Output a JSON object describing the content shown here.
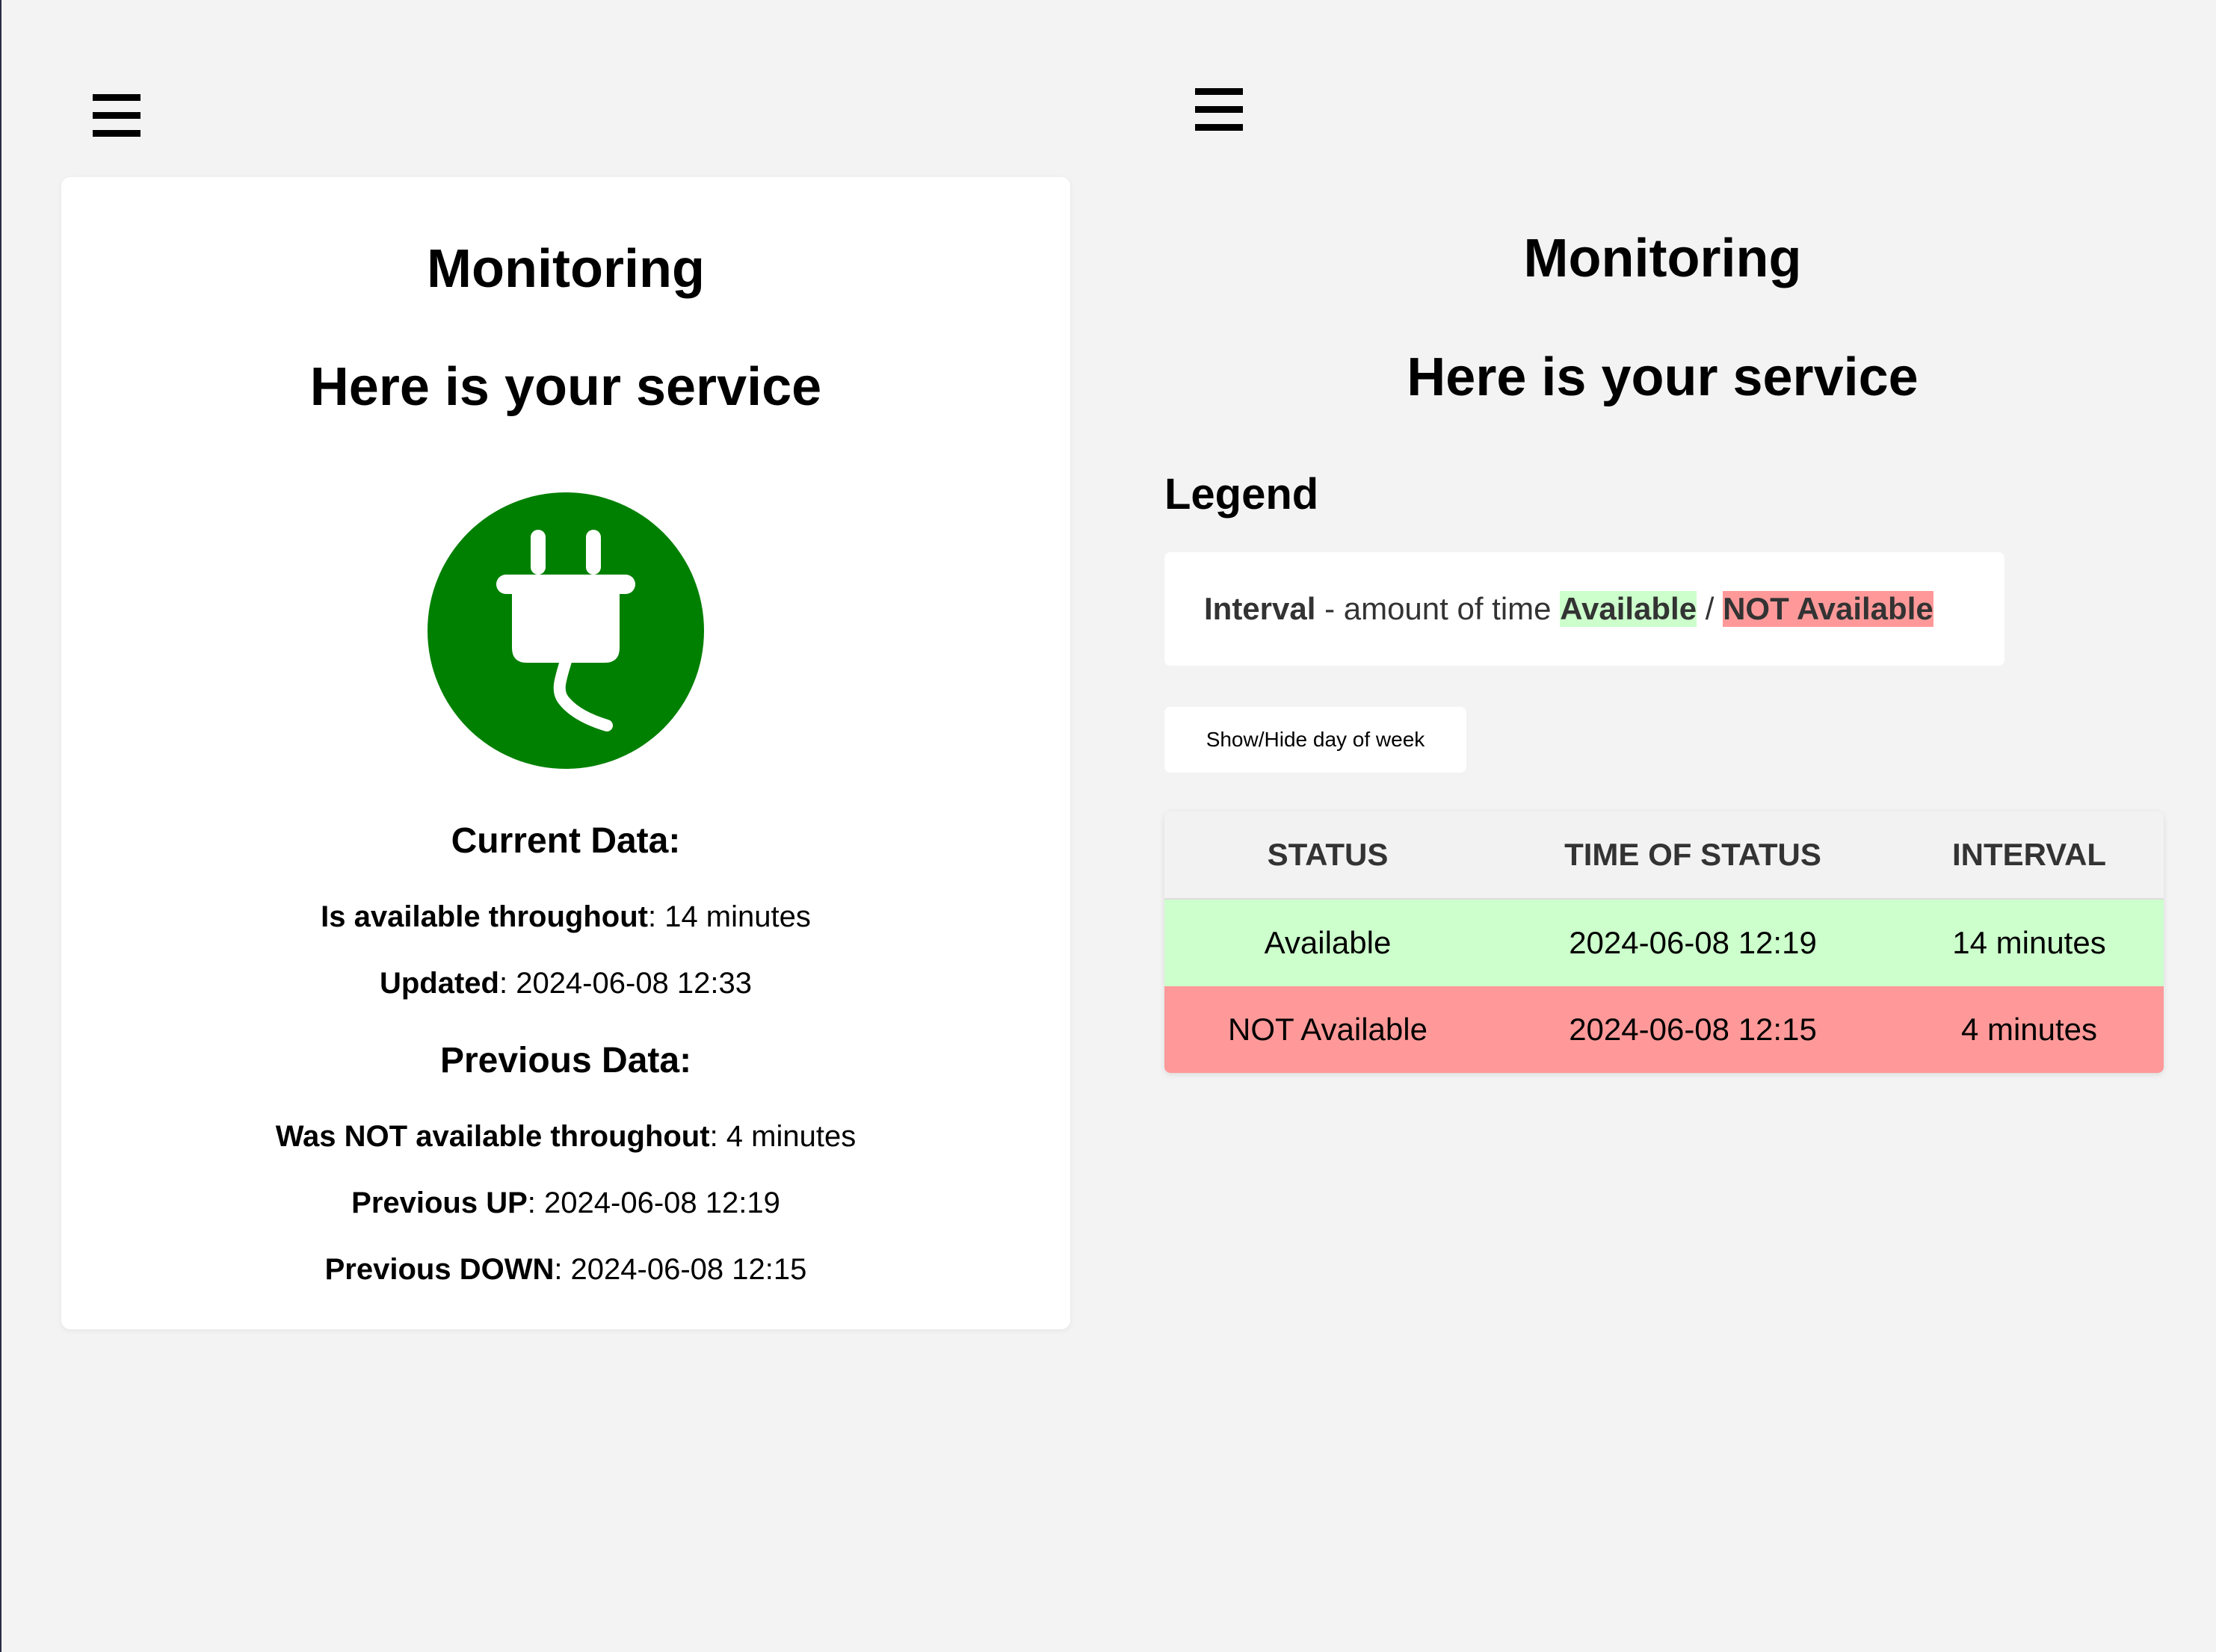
{
  "left_panel": {
    "title": "Monitoring",
    "subtitle": "Here is your service",
    "status_icon": "plug-icon",
    "status_color": "#008000",
    "current_heading": "Current Data:",
    "current": {
      "available_label": "Is available throughout",
      "available_value": ": 14 minutes",
      "updated_label": "Updated",
      "updated_value": ": 2024-06-08 12:33"
    },
    "previous_heading": "Previous Data:",
    "previous": {
      "not_available_label": "Was NOT available throughout",
      "not_available_value": ": 4 minutes",
      "up_label": "Previous UP",
      "up_value": ": 2024-06-08 12:19",
      "down_label": "Previous DOWN",
      "down_value": ": 2024-06-08 12:15"
    }
  },
  "right_panel": {
    "title": "Monitoring",
    "subtitle": "Here is your service",
    "legend_heading": "Legend",
    "legend": {
      "term": "Interval",
      "description": " - amount of time ",
      "available": "Available",
      "separator": " / ",
      "not_available": "NOT Available"
    },
    "toggle_button": "Show/Hide day of week",
    "table": {
      "headers": [
        "STATUS",
        "TIME OF STATUS",
        "INTERVAL"
      ],
      "rows": [
        {
          "status": "Available",
          "time": "2024-06-08 12:19",
          "interval": "14 minutes"
        },
        {
          "status": "NOT Available",
          "time": "2024-06-08 12:15",
          "interval": "4 minutes"
        }
      ]
    }
  },
  "colors": {
    "available_bg": "#ccffcc",
    "not_available_bg": "#ff9999",
    "page_bg": "#f3f3f3"
  }
}
